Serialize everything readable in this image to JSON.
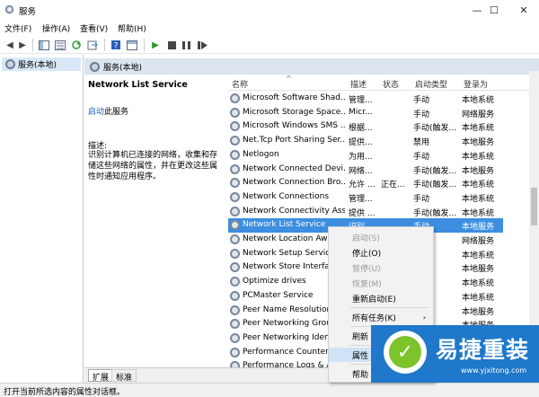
{
  "window": {
    "title": "服务",
    "min": "—",
    "max": "☐",
    "close": "✕"
  },
  "menu": [
    "文件(F)",
    "操作(A)",
    "查看(V)",
    "帮助(H)"
  ],
  "tree": {
    "root": "服务(本地)"
  },
  "panel": {
    "header": "服务(本地)"
  },
  "details": {
    "service_title": "Network List Service",
    "start_link": "启动",
    "start_suffix": "此服务",
    "desc_label": "描述:",
    "desc_text": "识别计算机已连接的网络，收集和存储这些网络的属性，并在更改这些属性时通知应用程序。"
  },
  "columns": {
    "name": "名称",
    "desc": "描述",
    "state": "状态",
    "start": "启动类型",
    "logon": "登录为"
  },
  "rows": [
    {
      "name": "Microsoft Software Shad...",
      "desc": "管理...",
      "state": "",
      "start": "手动",
      "logon": "本地系统"
    },
    {
      "name": "Microsoft Storage Space...",
      "desc": "Micr...",
      "state": "",
      "start": "手动",
      "logon": "网络服务"
    },
    {
      "name": "Microsoft Windows SMS ...",
      "desc": "根据...",
      "state": "",
      "start": "手动(触发...",
      "logon": "本地系统"
    },
    {
      "name": "Net.Tcp Port Sharing Ser...",
      "desc": "提供...",
      "state": "",
      "start": "禁用",
      "logon": "本地服务"
    },
    {
      "name": "Netlogon",
      "desc": "为用...",
      "state": "",
      "start": "手动",
      "logon": "本地系统"
    },
    {
      "name": "Network Connected Devi...",
      "desc": "网络...",
      "state": "",
      "start": "手动(触发...",
      "logon": "本地服务"
    },
    {
      "name": "Network Connection Bro...",
      "desc": "允许 ...",
      "state": "正在...",
      "start": "手动(触发...",
      "logon": "本地系统"
    },
    {
      "name": "Network Connections",
      "desc": "管理...",
      "state": "",
      "start": "手动",
      "logon": "本地系统"
    },
    {
      "name": "Network Connectivity Ass...",
      "desc": "提供 ...",
      "state": "",
      "start": "手动(触发...",
      "logon": "本地系统"
    },
    {
      "name": "Network List Service",
      "desc": "识别...",
      "state": "",
      "start": "手动",
      "logon": "本地服务"
    },
    {
      "name": "Network Location Awa",
      "desc": "",
      "state": "",
      "start": "",
      "logon": "网络服务"
    },
    {
      "name": "Network Setup Service",
      "desc": "",
      "state": "",
      "start": "",
      "logon": "本地系统"
    },
    {
      "name": "Network Store Interfac",
      "desc": "",
      "state": "",
      "start": "",
      "logon": "本地服务"
    },
    {
      "name": "Optimize drives",
      "desc": "",
      "state": "",
      "start": "",
      "logon": "本地系统"
    },
    {
      "name": "PCMaster Service",
      "desc": "",
      "state": "",
      "start": "",
      "logon": "本地系统"
    },
    {
      "name": "Peer Name Resolution",
      "desc": "",
      "state": "",
      "start": "",
      "logon": "本地服务"
    },
    {
      "name": "Peer Networking Grou",
      "desc": "",
      "state": "",
      "start": "",
      "logon": "本地服务"
    },
    {
      "name": "Peer Networking Ident",
      "desc": "",
      "state": "",
      "start": "",
      "logon": "本地服务"
    },
    {
      "name": "Performance Counter I",
      "desc": "",
      "state": "",
      "start": "",
      "logon": "本地服务"
    },
    {
      "name": "Performance Logs & A",
      "desc": "",
      "state": "",
      "start": "",
      "logon": "本地服务"
    }
  ],
  "context_menu": {
    "start": "启动(S)",
    "stop": "停止(O)",
    "pause": "暂停(U)",
    "resume": "恢复(M)",
    "restart": "重新启动(E)",
    "all_tasks": "所有任务(K)",
    "all_tasks_arrow": "›",
    "refresh": "刷新",
    "properties": "属性",
    "help": "帮助"
  },
  "tabs": [
    "扩展",
    "标准"
  ],
  "status": "打开当前所选内容的属性对话框。",
  "watermark": {
    "brand": "易捷重装",
    "url": "www.yjxitong.com"
  },
  "colors": {
    "selected": "#3d8ee0",
    "header": "#dbe4ef",
    "link": "#1a5ec4",
    "watermark_bg": "#1f78c9"
  }
}
